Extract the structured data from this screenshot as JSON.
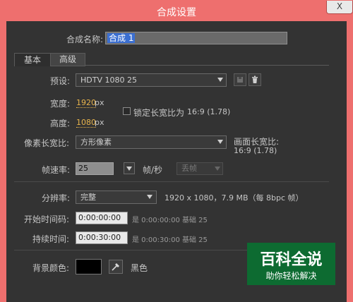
{
  "window": {
    "title": "合成设置",
    "close_glyph": "X"
  },
  "comp_name": {
    "label": "合成名称:",
    "value": "合成 1"
  },
  "tabs": [
    {
      "label": "基本"
    },
    {
      "label": "高级"
    }
  ],
  "preset": {
    "label": "预设:",
    "value": "HDTV 1080 25"
  },
  "width": {
    "label": "宽度:",
    "value": "1920",
    "unit": "px"
  },
  "height": {
    "label": "高度:",
    "value": "1080",
    "unit": "px"
  },
  "lock_aspect": {
    "label": "锁定长宽比为",
    "ratio": "16:9 (1.78)",
    "checked": false
  },
  "pixel_aspect": {
    "label": "像素长宽比:",
    "value": "方形像素"
  },
  "frame_aspect": {
    "label": "画面长宽比:",
    "value": "16:9 (1.78)"
  },
  "frame_rate": {
    "label": "帧速率:",
    "value": "25",
    "unit": "帧/秒",
    "drop_frame": "丢帧"
  },
  "resolution": {
    "label": "分辨率:",
    "value": "完整",
    "info": "1920 x 1080，7.9 MB（每 8bpc 帧）"
  },
  "start_timecode": {
    "label": "开始时间码:",
    "value": "0:00:00:00",
    "info": "是 0:00:00:00 基础 25"
  },
  "duration": {
    "label": "持续时间:",
    "value": "0:00:30:00",
    "info": "是 0:00:30:00 基础 25"
  },
  "bg_color": {
    "label": "背景颜色:",
    "name": "黑色",
    "color": "#000000"
  },
  "watermark": {
    "line1": "百科全说",
    "line2": "助你轻松解决"
  }
}
